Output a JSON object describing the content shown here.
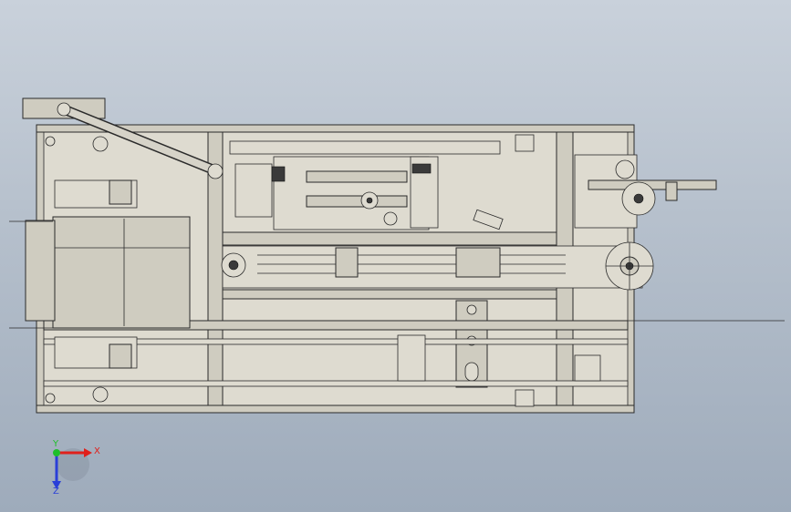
{
  "viewport": {
    "background_top": "#c9d1db",
    "background_bottom": "#9eabbb"
  },
  "model": {
    "frame_color": "#cfccc0",
    "edge_color": "#2a2a2a"
  },
  "triad": {
    "x_label": "X",
    "y_label": "Y",
    "z_label": "Z",
    "x_color": "#e0201b",
    "y_color": "#1fbf2a",
    "z_color": "#2a3fd8"
  }
}
